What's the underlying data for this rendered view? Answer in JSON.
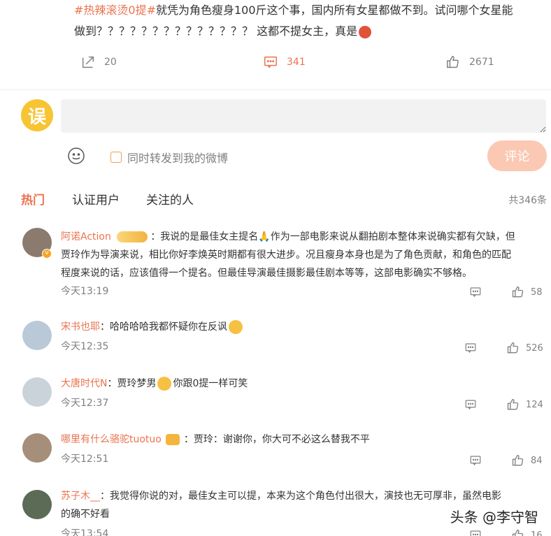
{
  "post": {
    "tag": "#热辣滚烫0提#",
    "text_line1": "就凭为角色瘦身100斤这个事，国内所有女星都做不到。试问哪个女星能",
    "text_line2": "做到？？？？？？？？？？？？？？ 这都不提女主，真是",
    "repost_count": "20",
    "comment_count": "341",
    "like_count": "2671"
  },
  "composer": {
    "avatar_text": "误",
    "input_value": "",
    "repost_label": "同时转发到我的微博",
    "submit_label": "评论"
  },
  "tabs": {
    "hot": "热门",
    "verified": "认证用户",
    "following": "关注的人",
    "total": "共346条"
  },
  "comments": [
    {
      "name": "阿诺Action",
      "text_line1": "：我说的是最佳女主提名🙏作为一部电影来说从翻拍剧本整体来说确实都有欠缺，但",
      "text_line2": "贾玲作为导演来说，相比你好李焕英时期都有很大进步。况且瘦身本身也是为了角色贡献，和角色的匹配",
      "text_line3": "程度来说的话，应该值得一个提名。但最佳导演最佳摄影最佳剧本等等，这部电影确实不够格。",
      "time": "今天13:19",
      "likes": "58",
      "avatar_color": "#8a7b6e"
    },
    {
      "name": "宋书也耶",
      "text_line1": "：哈哈哈哈我都怀疑你在反讽",
      "time": "今天12:35",
      "likes": "526",
      "avatar_color": "#b9c9d8"
    },
    {
      "name": "大唐时代N",
      "text_line1": "：贾玲梦男",
      "text_line1b": "你跟0提一样可笑",
      "time": "今天12:37",
      "likes": "124",
      "avatar_color": "#c9d3d9"
    },
    {
      "name": "哪里有什么骆驼tuotuo",
      "text_line1": "：贾玲：谢谢你，你大可不必这么替我不平",
      "time": "今天12:51",
      "likes": "84",
      "avatar_color": "#a58f7a"
    },
    {
      "name": "苏子木__",
      "text_line1": "：我觉得你说的对，最佳女主可以提，本来为这个角色付出很大，演技也无可厚非，虽然电影",
      "text_line2": "的确不好看",
      "time": "今天13:54",
      "likes": "16",
      "avatar_color": "#5b6b55"
    }
  ],
  "watermark": "头条 @李守智"
}
